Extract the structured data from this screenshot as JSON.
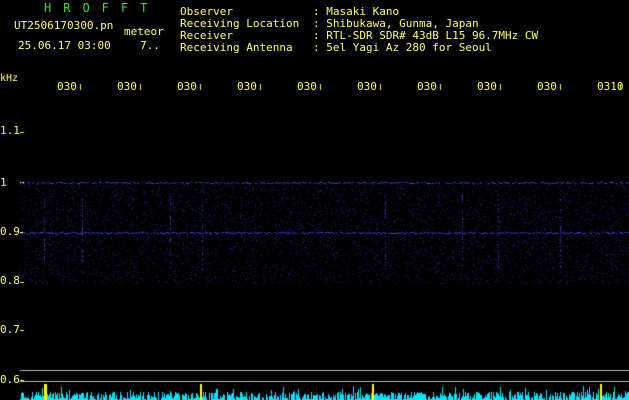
{
  "app": {
    "name": "HROFFT"
  },
  "file": {
    "name": "UT2506170300.pn",
    "mode": "meteor",
    "datetime": "25.06.17 03:00",
    "extra": "7.."
  },
  "info": [
    {
      "label": "Observer",
      "value": ": Masaki Kano"
    },
    {
      "label": "Receiving Location",
      "value": ": Shibukawa, Gunma, Japan"
    },
    {
      "label": "Receiver",
      "value": ": RTL-SDR SDR# 43dB L15 96.7MHz CW"
    },
    {
      "label": "Receiving Antenna",
      "value": ": 5el Yagi Az 280 for Seoul"
    }
  ],
  "axis": {
    "unit": "kHz",
    "x_ticks": [
      "030",
      "030",
      "030",
      "030",
      "030",
      "030",
      "030",
      "030",
      "030",
      "0310"
    ],
    "y_ticks": [
      "1.1",
      "1",
      "0.9",
      "0.8",
      "0.7",
      "0.6"
    ]
  },
  "colors": {
    "background": "#000000",
    "text": "#ffff66",
    "brand": "#33dd33",
    "signal": "#3344ff",
    "grid": "#cccccc",
    "spectrum": "#00ffff"
  }
}
